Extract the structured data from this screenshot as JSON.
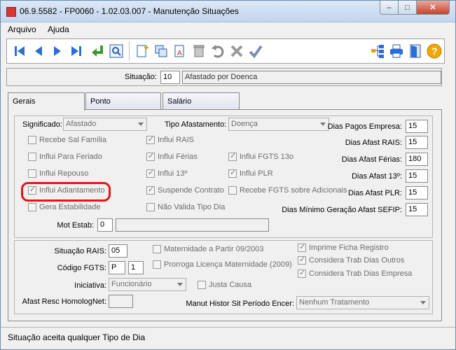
{
  "window": {
    "title": "06.9.5582 - FP0060 - 1.02.03.007 - Manutenção Situações",
    "min": "–",
    "max": "□",
    "close": "✕"
  },
  "menu": {
    "items": [
      "Arquivo",
      "Ajuda"
    ]
  },
  "toolbar": {
    "icons": [
      "first-icon",
      "prev-icon",
      "next-icon",
      "last-icon",
      "goto-icon",
      "zoom-icon",
      "new-icon",
      "copy-icon",
      "edit-icon",
      "delete-icon",
      "undo-icon",
      "cancel-icon",
      "save-icon",
      "tree-icon",
      "print-icon",
      "exit-icon",
      "help-icon"
    ]
  },
  "situacao": {
    "label": "Situação:",
    "code": "10",
    "description": "Afastado por Doenca"
  },
  "tabs": [
    "Gerais",
    "Ponto",
    "Salário"
  ],
  "gerais": {
    "significado_label": "Significado:",
    "significado_value": "Afastado",
    "tipo_afastamento_label": "Tipo Afastamento:",
    "tipo_afastamento_value": "Doença",
    "checks_col1": [
      {
        "label": "Recebe Sal Família",
        "checked": false
      },
      {
        "label": "Influi Para Feriado",
        "checked": false
      },
      {
        "label": "Influi Repouso",
        "checked": false
      },
      {
        "label": "Influi Adiantamento",
        "checked": true
      },
      {
        "label": "Gera Estabilidade",
        "checked": false
      }
    ],
    "checks_col2": [
      {
        "label": "Influi RAIS",
        "checked": true
      },
      {
        "label": "Influi Férias",
        "checked": true
      },
      {
        "label": "Influi 13º",
        "checked": true
      },
      {
        "label": "Suspende Contrato",
        "checked": true
      },
      {
        "label": "Não Valida Tipo Dia",
        "checked": false
      }
    ],
    "checks_col3": [
      {
        "label": "Influi FGTS 13o",
        "checked": true
      },
      {
        "label": "Influi PLR",
        "checked": true
      },
      {
        "label": "Recebe FGTS sobre Adicionais",
        "checked": false
      }
    ],
    "dias": [
      {
        "label": "Dias Pagos Empresa:",
        "value": "15"
      },
      {
        "label": "Dias Afast RAIS:",
        "value": "15"
      },
      {
        "label": "Dias Afast Férias:",
        "value": "180"
      },
      {
        "label": "Dias Afast 13º:",
        "value": "15"
      },
      {
        "label": "Dias Afast PLR:",
        "value": "15"
      },
      {
        "label": "Dias Mínimo Geração Afast SEFIP:",
        "value": "15"
      }
    ],
    "mot_estab_label": "Mot Estab:",
    "mot_estab_code": "0",
    "mot_estab_desc": ""
  },
  "bottom": {
    "situacao_rais_label": "Situação RAIS:",
    "situacao_rais_value": "05",
    "codigo_fgts_label": "Código FGTS:",
    "codigo_fgts_value": "P",
    "codigo_fgts_value2": "1",
    "iniciativa_label": "Iniciativa:",
    "iniciativa_value": "Funcionário",
    "afast_resc_label": "Afast Resc HomologNet:",
    "afast_resc_value": "",
    "maternidade": "Maternidade a Partir 09/2003",
    "prorroga": "Prorroga Licença Maternidade (2009)",
    "justa_causa": "Justa Causa",
    "imprime_ficha": "Imprime Ficha Registro",
    "considera_outros": "Considera Trab Dias Outros",
    "considera_empresa": "Considera Trab Dias Empresa",
    "manut_label": "Manut Histor Sit Período Encer:",
    "manut_value": "Nenhum Tratamento"
  },
  "status": "Situação aceita qualquer Tipo de Dia"
}
